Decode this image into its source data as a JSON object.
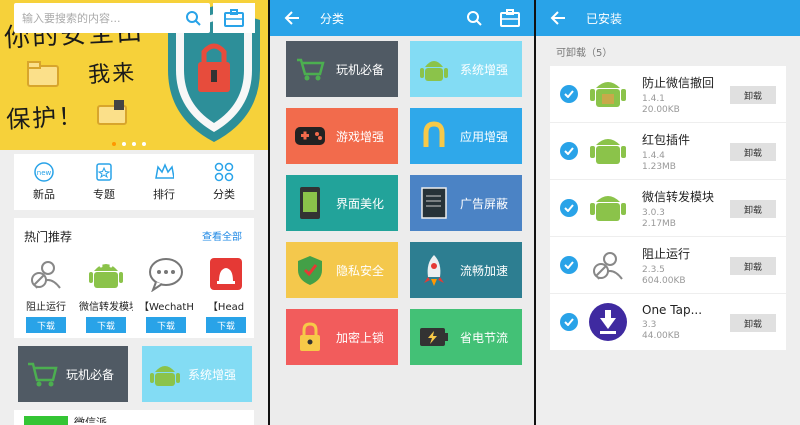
{
  "home": {
    "search_placeholder": "输入要搜索的内容...",
    "banner_lines": [
      "你的安全由",
      "我来",
      "保护！"
    ],
    "nav": [
      "新品",
      "专题",
      "排行",
      "分类"
    ],
    "new_badge": "new",
    "hot": {
      "title": "热门推荐",
      "more": "查看全部",
      "apps": [
        {
          "name": "阻止运行",
          "download": "下载"
        },
        {
          "name": "微信转发模块",
          "download": "下载"
        },
        {
          "name": "【WechatHelper】",
          "download": "下载"
        },
        {
          "name": "【Head",
          "download": "下载"
        }
      ]
    },
    "tiles": [
      "玩机必备",
      "系统增强"
    ],
    "bottom_label": "微信派"
  },
  "categories": {
    "title": "分类",
    "items": [
      {
        "label": "玩机必备",
        "color": "#505a64"
      },
      {
        "label": "系统增强",
        "color": "#83dcf4"
      },
      {
        "label": "游戏增强",
        "color": "#f26b4c"
      },
      {
        "label": "应用增强",
        "color": "#2fa8ea"
      },
      {
        "label": "界面美化",
        "color": "#22a39a"
      },
      {
        "label": "广告屏蔽",
        "color": "#4b83c5"
      },
      {
        "label": "隐私安全",
        "color": "#f4c84c"
      },
      {
        "label": "流畅加速",
        "color": "#2d7e91"
      },
      {
        "label": "加密上锁",
        "color": "#f25c5c"
      },
      {
        "label": "省电节流",
        "color": "#43c176"
      }
    ]
  },
  "installed": {
    "title": "已安装",
    "subtitle": "可卸载（5）",
    "uninstall": "卸载",
    "apps": [
      {
        "name": "防止微信撤回",
        "version": "1.4.1",
        "size": "20.00KB"
      },
      {
        "name": "红包插件",
        "version": "1.4.4",
        "size": "1.23MB"
      },
      {
        "name": "微信转发模块",
        "version": "3.0.3",
        "size": "2.17MB"
      },
      {
        "name": "阻止运行",
        "version": "2.3.5",
        "size": "604.00KB"
      },
      {
        "name": "One Tap...",
        "version": "3.3",
        "size": "44.00KB"
      }
    ]
  }
}
